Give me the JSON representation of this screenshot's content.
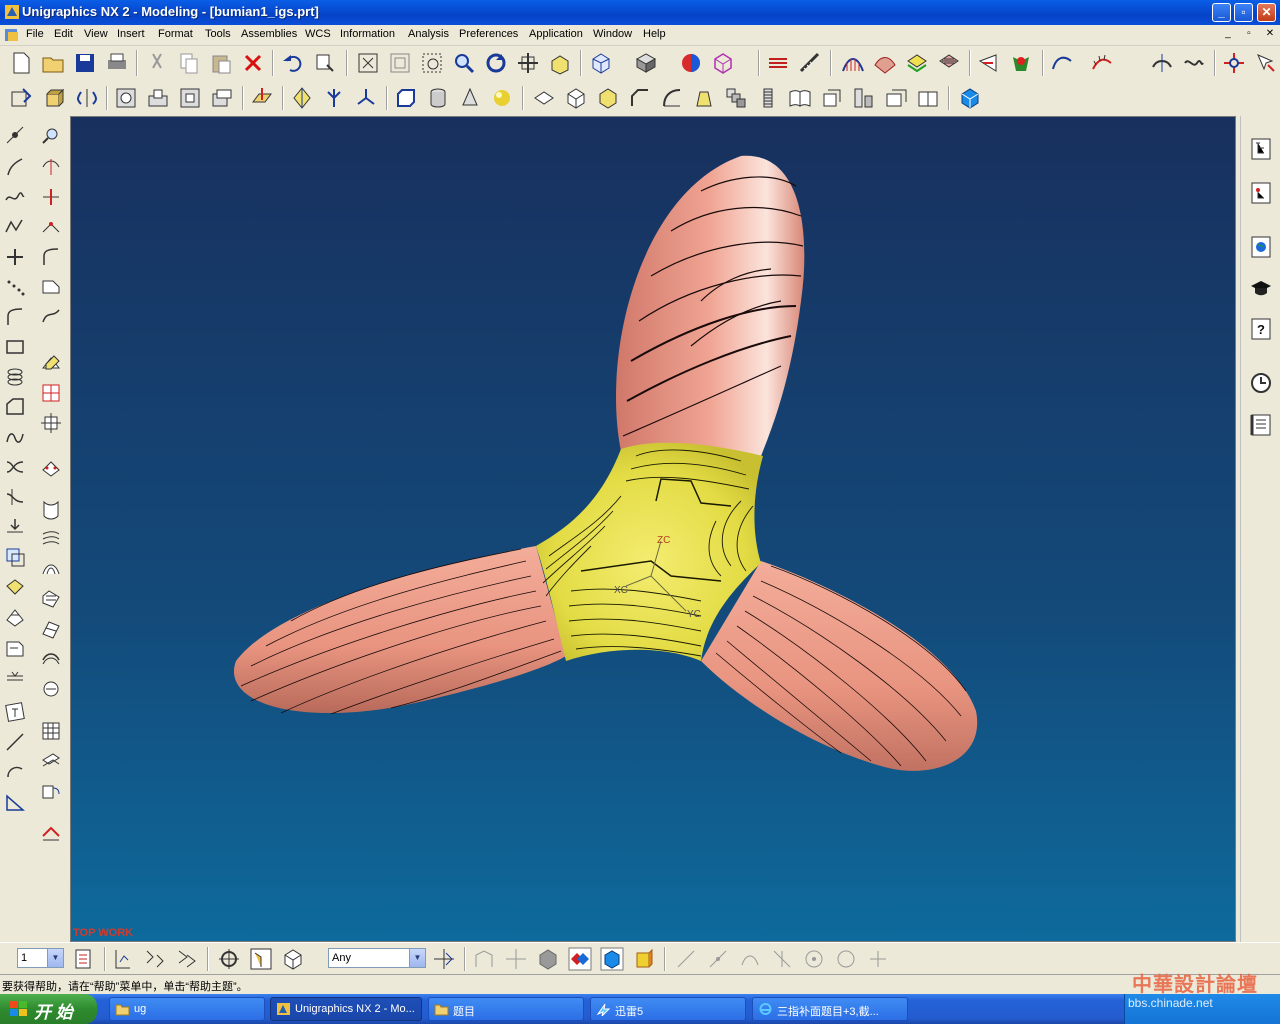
{
  "window": {
    "title": "Unigraphics NX 2 - Modeling - [bumian1_igs.prt]",
    "min_label": "_",
    "max_label": "▫",
    "close_label": "✕"
  },
  "menubar": {
    "items": [
      "File",
      "Edit",
      "View",
      "Insert",
      "Format",
      "Tools",
      "Assemblies",
      "WCS",
      "Information",
      "Analysis",
      "Preferences",
      "Application",
      "Window",
      "Help"
    ],
    "mdi_min": "_",
    "mdi_restore": "▫",
    "mdi_close": "✕"
  },
  "viewport": {
    "view_label": "TOP WORK",
    "axis_labels": {
      "zc": "ZC",
      "xc": "XC",
      "yc": "YC"
    }
  },
  "bottom_toolbar": {
    "layer_value": "1",
    "filter_value": "Any"
  },
  "status": {
    "message": "要获得帮助，请在“帮助”菜单中，单击“帮助主题”。"
  },
  "taskbar": {
    "start_label": "开 始",
    "tasks": [
      {
        "label": "ug",
        "icon": "folder-icon"
      },
      {
        "label": "Unigraphics NX 2 - Mo...",
        "icon": "nx-icon"
      },
      {
        "label": "题目",
        "icon": "folder-icon"
      },
      {
        "label": "迅雷5",
        "icon": "thunder-icon"
      },
      {
        "label": "三指补面题目+3,截...",
        "icon": "ie-icon"
      }
    ]
  },
  "watermark": {
    "title": "中華設計論壇",
    "url": "bbs.chinade.net"
  },
  "colors": {
    "surface_salmon": "#e8988a",
    "surface_yellow": "#e6e050",
    "viewport_top": "#18305e",
    "viewport_bottom": "#0e6a9c"
  }
}
